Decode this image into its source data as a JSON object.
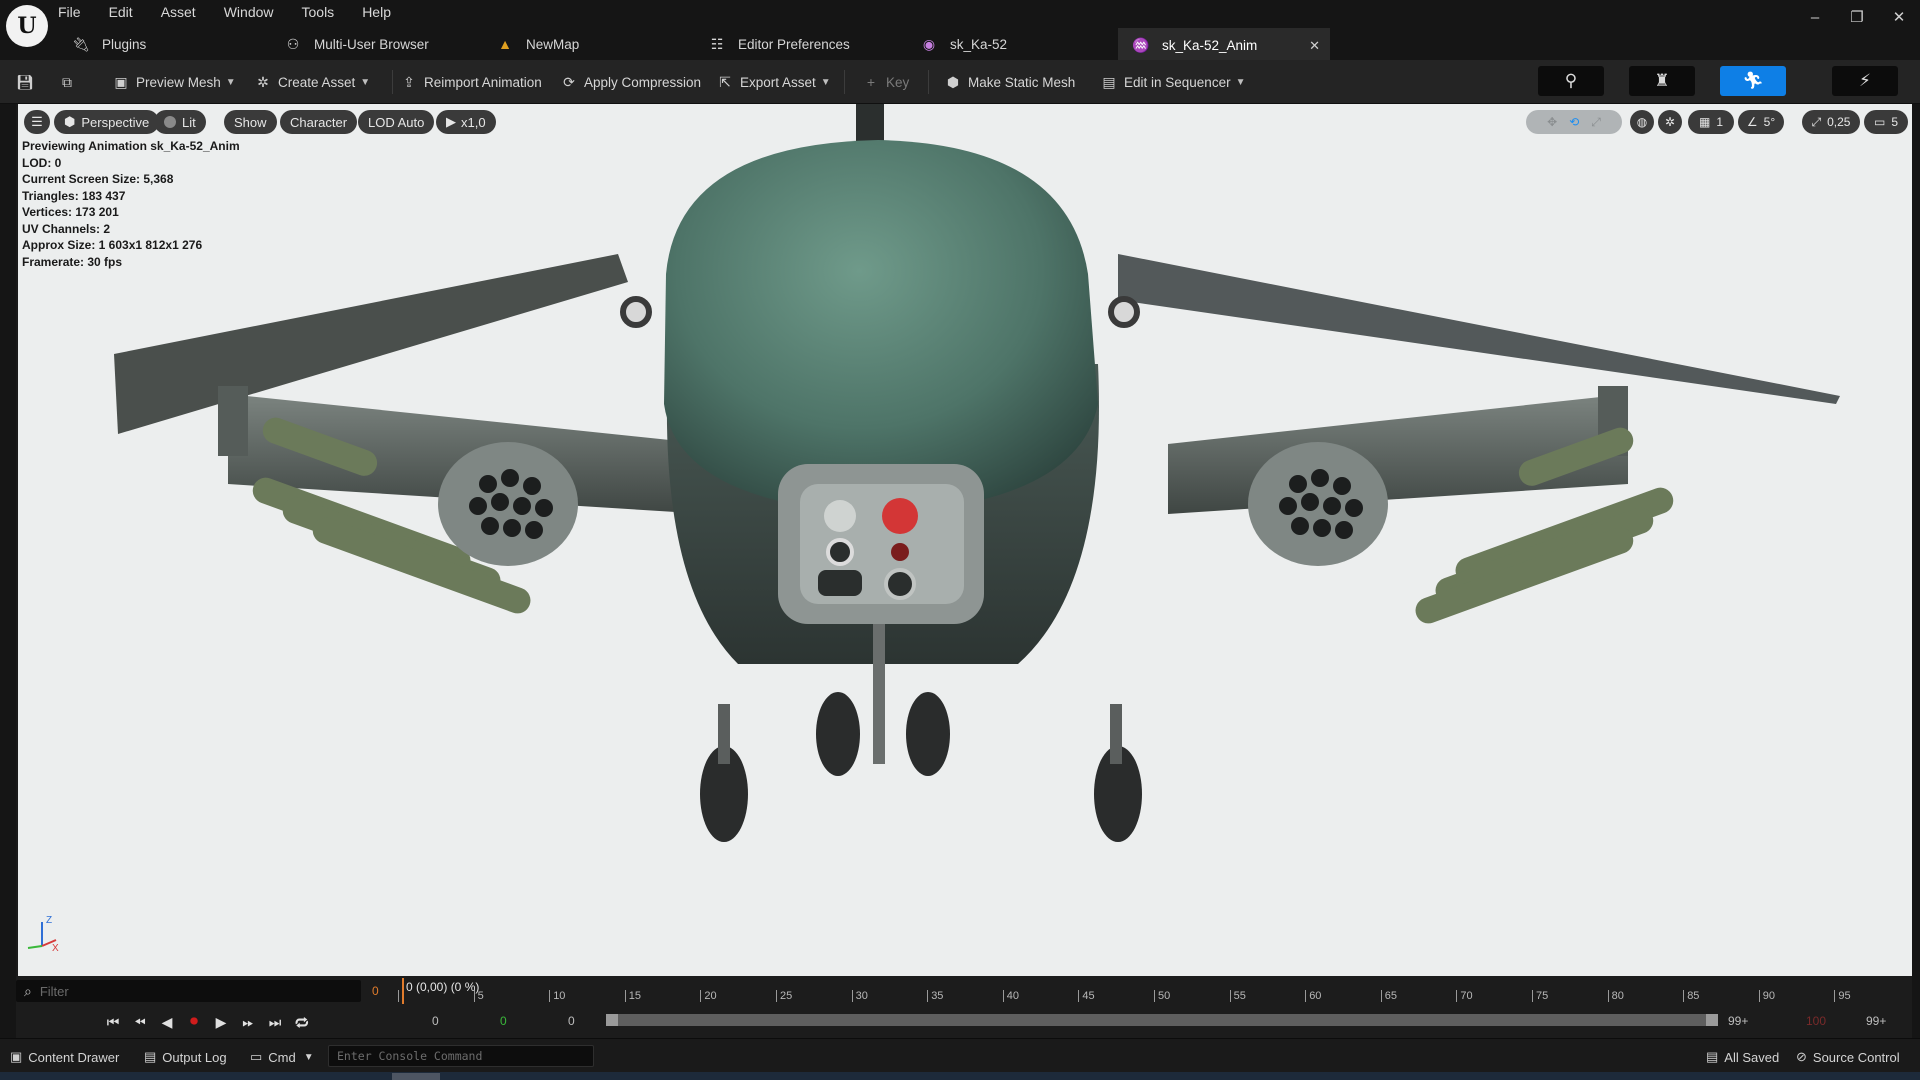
{
  "app": {
    "menu": [
      "File",
      "Edit",
      "Asset",
      "Window",
      "Tools",
      "Help"
    ],
    "window_controls": {
      "minimize": "–",
      "restore": "❐",
      "close": "✕"
    }
  },
  "tabs": [
    {
      "label": "Plugins",
      "icon": "plug-icon"
    },
    {
      "label": "Multi-User Browser",
      "icon": "users-icon"
    },
    {
      "label": "NewMap",
      "icon": "level-icon"
    },
    {
      "label": "Editor Preferences",
      "icon": "sliders-icon"
    },
    {
      "label": "sk_Ka-52",
      "icon": "skeleton-icon"
    },
    {
      "label": "sk_Ka-52_Anim",
      "icon": "animation-icon",
      "active": true
    }
  ],
  "toolbar": {
    "preview_mesh": "Preview Mesh",
    "create_asset": "Create Asset",
    "reimport_animation": "Reimport Animation",
    "apply_compression": "Apply Compression",
    "export_asset": "Export Asset",
    "key": "Key",
    "make_static_mesh": "Make Static Mesh",
    "edit_in_sequencer": "Edit in Sequencer"
  },
  "viewport": {
    "perspective": "Perspective",
    "lit": "Lit",
    "show": "Show",
    "character": "Character",
    "lod": "LOD Auto",
    "play_rate": "x1,0",
    "grid_snap": "1",
    "rotation_snap": "5°",
    "scale_snap": "0,25",
    "camera_speed": "5",
    "stats": [
      "Previewing Animation sk_Ka-52_Anim",
      "LOD: 0",
      "Current Screen Size: 5,368",
      "Triangles: 183 437",
      "Vertices: 173 201",
      "UV Channels: 2",
      "Approx Size: 1 603x1 812x1 276",
      "Framerate: 30 fps"
    ],
    "axis": {
      "z": "Z",
      "x": "X"
    }
  },
  "timeline": {
    "filter_placeholder": "Filter",
    "current_frame": "0",
    "playhead": "0 (0,00) (0 %)",
    "tick_labels": [
      "5",
      "10",
      "15",
      "20",
      "25",
      "30",
      "35",
      "40",
      "45",
      "50",
      "55",
      "60",
      "65",
      "70",
      "75",
      "80",
      "85",
      "90",
      "95"
    ],
    "counter_start": "0",
    "counter_mid": "0",
    "counter_end": "0",
    "range_end_a": "99+",
    "range_end_b": "100",
    "range_end_c": "99+"
  },
  "statusbar": {
    "content_drawer": "Content Drawer",
    "output_log": "Output Log",
    "cmd": "Cmd",
    "console_placeholder": "Enter Console Command",
    "all_saved": "All Saved",
    "source_control": "Source Control"
  },
  "colors": {
    "accent": "#0e7fe6",
    "record": "#d01c1c",
    "playhead": "#e07b2c",
    "viewport_bg": "#eceeee"
  }
}
